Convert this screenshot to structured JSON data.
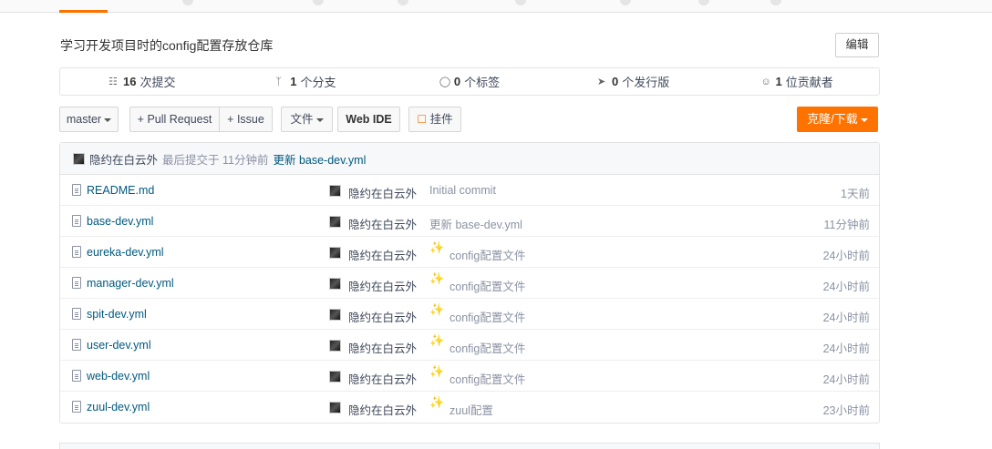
{
  "repo": {
    "description": "学习开发项目时的config配置存放仓库",
    "edit_label": "编辑"
  },
  "stats": [
    {
      "icon": "commit-icon",
      "count": "16",
      "label": "次提交"
    },
    {
      "icon": "branch-icon",
      "count": "1",
      "label": "个分支"
    },
    {
      "icon": "tag-icon",
      "count": "0",
      "label": "个标签"
    },
    {
      "icon": "release-icon",
      "count": "0",
      "label": "个发行版"
    },
    {
      "icon": "contributors-icon",
      "count": "1",
      "label": "位贡献者"
    }
  ],
  "toolbar": {
    "branch": "master",
    "pull_request": "+ Pull Request",
    "issue": "+ Issue",
    "file": "文件",
    "web_ide": "Web IDE",
    "widget": "挂件",
    "clone": "克隆/下载"
  },
  "last_commit": {
    "author": "隐约在白云外",
    "meta": "最后提交于 11分钟前",
    "message": "更新 base-dev.yml"
  },
  "files": [
    {
      "name": "README.md",
      "author": "隐约在白云外",
      "message": "Initial commit",
      "sparkle": false,
      "time": "1天前"
    },
    {
      "name": "base-dev.yml",
      "author": "隐约在白云外",
      "message": "更新 base-dev.yml",
      "sparkle": false,
      "time": "11分钟前"
    },
    {
      "name": "eureka-dev.yml",
      "author": "隐约在白云外",
      "message": "config配置文件",
      "sparkle": true,
      "time": "24小时前"
    },
    {
      "name": "manager-dev.yml",
      "author": "隐约在白云外",
      "message": "config配置文件",
      "sparkle": true,
      "time": "24小时前"
    },
    {
      "name": "spit-dev.yml",
      "author": "隐约在白云外",
      "message": "config配置文件",
      "sparkle": true,
      "time": "24小时前"
    },
    {
      "name": "user-dev.yml",
      "author": "隐约在白云外",
      "message": "config配置文件",
      "sparkle": true,
      "time": "24小时前"
    },
    {
      "name": "web-dev.yml",
      "author": "隐约在白云外",
      "message": "config配置文件",
      "sparkle": true,
      "time": "24小时前"
    },
    {
      "name": "zuul-dev.yml",
      "author": "隐约在白云外",
      "message": "zuul配置",
      "sparkle": true,
      "time": "23小时前"
    }
  ],
  "colors": {
    "accent": "#fe7300",
    "link": "#005980",
    "muted": "#8c92a4"
  }
}
